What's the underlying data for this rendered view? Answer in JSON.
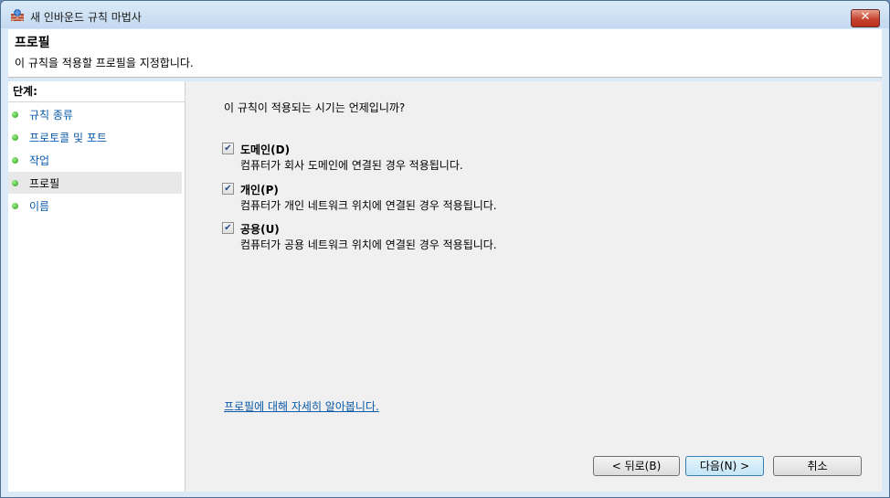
{
  "window": {
    "title": "새 인바운드 규칙 마법사",
    "close_glyph": "✕"
  },
  "header": {
    "title": "프로필",
    "description": "이 규칙을 적용할 프로필을 지정합니다."
  },
  "sidebar": {
    "heading": "단계:",
    "items": [
      {
        "label": "규칙 종류",
        "active": false
      },
      {
        "label": "프로토콜 및 포트",
        "active": false
      },
      {
        "label": "작업",
        "active": false
      },
      {
        "label": "프로필",
        "active": true
      },
      {
        "label": "이름",
        "active": false
      }
    ]
  },
  "content": {
    "question": "이 규칙이 적용되는 시기는 언제입니까?",
    "options": [
      {
        "title": "도메인(D)",
        "description": "컴퓨터가 회사 도메인에 연결된 경우 적용됩니다.",
        "checked": true
      },
      {
        "title": "개인(P)",
        "description": "컴퓨터가 개인 네트워크 위치에 연결된 경우 적용됩니다.",
        "checked": true
      },
      {
        "title": "공용(U)",
        "description": "컴퓨터가 공용 네트워크 위치에 연결된 경우 적용됩니다.",
        "checked": true
      }
    ],
    "help_link": "프로필에 대해 자세히 알아봅니다."
  },
  "buttons": {
    "back": "< 뒤로(B)",
    "next": "다음(N) >",
    "cancel": "취소"
  },
  "icons": {
    "window": "firewall-icon",
    "check": "✔"
  }
}
